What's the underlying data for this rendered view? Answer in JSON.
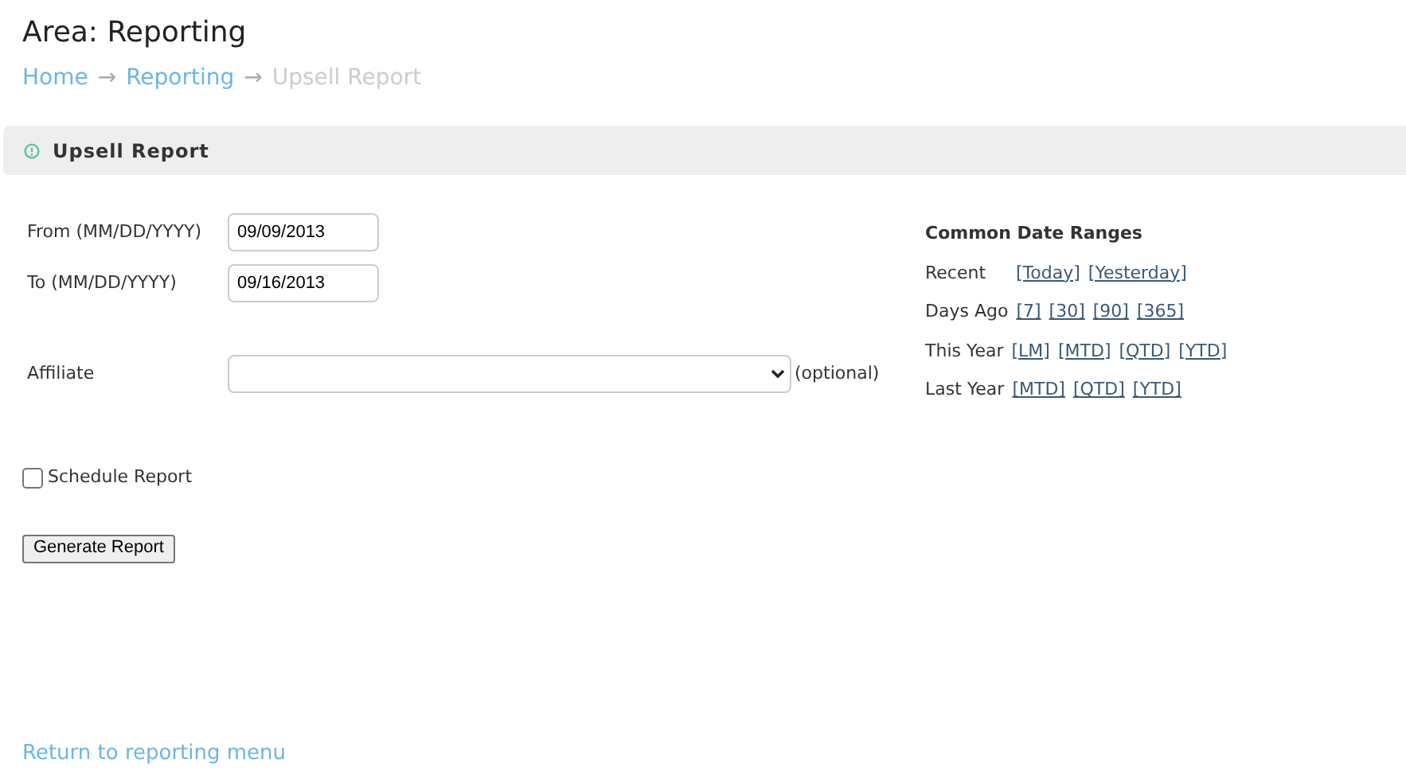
{
  "page_title": "Area: Reporting",
  "breadcrumb": [
    {
      "label": "Home",
      "current": false
    },
    {
      "label": "Reporting",
      "current": false
    },
    {
      "label": "Upsell Report",
      "current": true
    }
  ],
  "breadcrumb_separator": "→",
  "panel_title": "Upsell Report",
  "form": {
    "from_label": "From (MM/DD/YYYY)",
    "from_value": "09/09/2013",
    "to_label": "To (MM/DD/YYYY)",
    "to_value": "09/16/2013",
    "affiliate_label": "Affiliate",
    "affiliate_note": "(optional)",
    "schedule_label": "Schedule Report",
    "schedule_checked": false,
    "submit": "Generate Report"
  },
  "date_ranges": {
    "title": "Common Date Ranges",
    "rows": [
      {
        "label": "Recent",
        "links": [
          "[Today]",
          "[Yesterday]"
        ]
      },
      {
        "label": "Days Ago",
        "links": [
          "[7]",
          "[30]",
          "[90]",
          "[365]"
        ]
      },
      {
        "label": "This Year",
        "links": [
          "[LM]",
          "[MTD]",
          "[QTD]",
          "[YTD]"
        ]
      },
      {
        "label": "Last Year",
        "links": [
          "[MTD]",
          "[QTD]",
          "[YTD]"
        ]
      }
    ]
  },
  "footer_link": "Return to reporting menu"
}
